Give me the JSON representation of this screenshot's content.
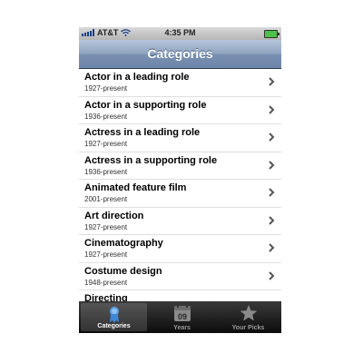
{
  "status": {
    "carrier": "AT&T",
    "time": "4:35 PM"
  },
  "nav": {
    "title": "Categories"
  },
  "rows": [
    {
      "title": "Actor in a leading role",
      "subtitle": "1927-present"
    },
    {
      "title": "Actor in a supporting role",
      "subtitle": "1936-present"
    },
    {
      "title": "Actress in a leading role",
      "subtitle": "1927-present"
    },
    {
      "title": "Actress in a supporting role",
      "subtitle": "1936-present"
    },
    {
      "title": "Animated feature film",
      "subtitle": "2001-present"
    },
    {
      "title": "Art direction",
      "subtitle": "1927-present"
    },
    {
      "title": "Cinematography",
      "subtitle": "1927-present"
    },
    {
      "title": "Costume design",
      "subtitle": "1948-present"
    },
    {
      "title": "Directing",
      "subtitle": ""
    }
  ],
  "tabs": [
    {
      "label": "Categories",
      "icon": "ribbon-icon",
      "active": true
    },
    {
      "label": "Years",
      "icon": "calendar-icon",
      "active": false,
      "icon_text": "09"
    },
    {
      "label": "Your Picks",
      "icon": "star-icon",
      "active": false
    }
  ],
  "colors": {
    "navbar": "#7990b1",
    "tabbar": "#1a1a1a",
    "accent": "#4f8fd8"
  }
}
